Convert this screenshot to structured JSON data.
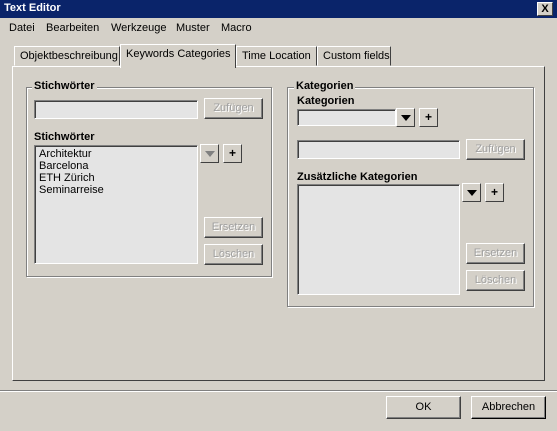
{
  "window": {
    "title": "Text Editor",
    "close_glyph": "X"
  },
  "menu": [
    "Datei",
    "Bearbeiten",
    "Werkzeuge",
    "Muster",
    "Macro"
  ],
  "tabs": [
    "Objektbeschreibung",
    "Keywords Categories",
    "Time Location",
    "Custom fields"
  ],
  "active_tab": "Keywords Categories",
  "keywords": {
    "group_title": "Stichwörter",
    "input_value": "",
    "add_label": "Zufügen",
    "list_label": "Stichwörter",
    "items": [
      "Architektur",
      "Barcelona",
      "ETH Zürich",
      "Seminarreise"
    ],
    "plus_label": "+",
    "replace_label": "Ersetzen",
    "delete_label": "Löschen"
  },
  "categories": {
    "group_title": "Kategorien",
    "select_label": "Kategorien",
    "select_value": "",
    "plus_label": "+",
    "input_value": "",
    "add_label": "Zufügen",
    "extra_label": "Zusätzliche Kategorien",
    "extra_plus_label": "+",
    "replace_label": "Ersetzen",
    "delete_label": "Löschen"
  },
  "footer": {
    "ok_label": "OK",
    "cancel_label": "Abbrechen"
  },
  "icons": {
    "dropdown": "triangle-down-icon",
    "add": "plus-icon"
  }
}
